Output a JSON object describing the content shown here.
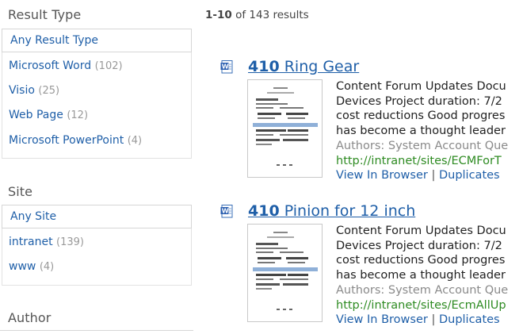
{
  "refiners": {
    "result_type": {
      "title": "Result Type",
      "selected": "Any Result Type",
      "items": [
        {
          "label": "Microsoft Word",
          "count": "(102)"
        },
        {
          "label": "Visio",
          "count": "(25)"
        },
        {
          "label": "Web Page",
          "count": "(12)"
        },
        {
          "label": "Microsoft PowerPoint",
          "count": "(4)"
        }
      ]
    },
    "site": {
      "title": "Site",
      "selected": "Any Site",
      "items": [
        {
          "label": "intranet",
          "count": "(139)"
        },
        {
          "label": "www",
          "count": "(4)"
        }
      ]
    },
    "author": {
      "title": "Author"
    }
  },
  "results_count": {
    "range": "1-10",
    "text": "of 143 results"
  },
  "results": [
    {
      "title_num": "410",
      "title_rest": " Ring Gear",
      "icon": "word-doc-icon",
      "summary": [
        "Content Forum Updates Docu",
        "Devices Project duration: 7/2",
        "cost reductions Good progres",
        "has become a thought leader"
      ],
      "authors": "Authors: System Account Que",
      "url": "http://intranet/sites/ECMForT",
      "view_label": "View In Browser",
      "separator": "|",
      "duplicates_label": "Duplicates"
    },
    {
      "title_num": "410",
      "title_rest": " Pinion for 12 inch",
      "icon": "word-doc-icon",
      "summary": [
        "Content Forum Updates Docu",
        "Devices Project duration: 7/2",
        "cost reductions Good progres",
        "has become a thought leader"
      ],
      "authors": "Authors: System Account Que",
      "url": "http://intranet/sites/EcmAllUp",
      "view_label": "View In Browser",
      "separator": "|",
      "duplicates_label": "Duplicates"
    }
  ]
}
